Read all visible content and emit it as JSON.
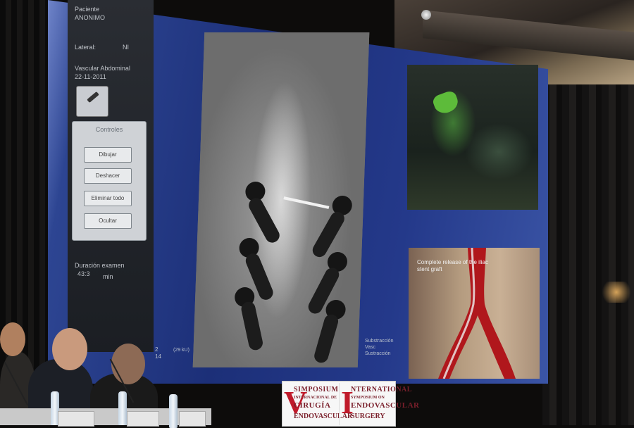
{
  "panel": {
    "line1": "Paciente",
    "line2": "ANONIMO",
    "line3": "Lateral:",
    "line3_value": "NI",
    "line4": "Vascular Abdominal",
    "line5": "22-11-2011",
    "controls_title": "Controles",
    "buttons": [
      "Dibujar",
      "Deshacer",
      "Eliminar todo",
      "Ocultar"
    ],
    "exam_label": "Duración examen",
    "exam_value": "43:3",
    "exam_unit": "min"
  },
  "xray": {
    "numbers": [
      "2",
      "14"
    ],
    "label_1": "(29 kU)",
    "labels": [
      "Substracción",
      "Vasc",
      "Sustracción"
    ]
  },
  "graft_caption": "Complete release of the iliac stent graft",
  "banner": {
    "left_initial": "V",
    "left_lines": [
      "SIMPOSIUM",
      "INTERNACIONAL DE",
      "CIRUGÍA",
      "ENDOVASCULAR"
    ],
    "right_initial": "I",
    "right_lines": [
      "NTERNATIONAL",
      "SYMPOSIUM ON",
      "ENDOVASCULAR",
      "SURGERY"
    ]
  },
  "colors": {
    "screen_blue": "#1c2f78",
    "banner_red": "#c01a2a",
    "banner_text": "#7a1f2b"
  }
}
